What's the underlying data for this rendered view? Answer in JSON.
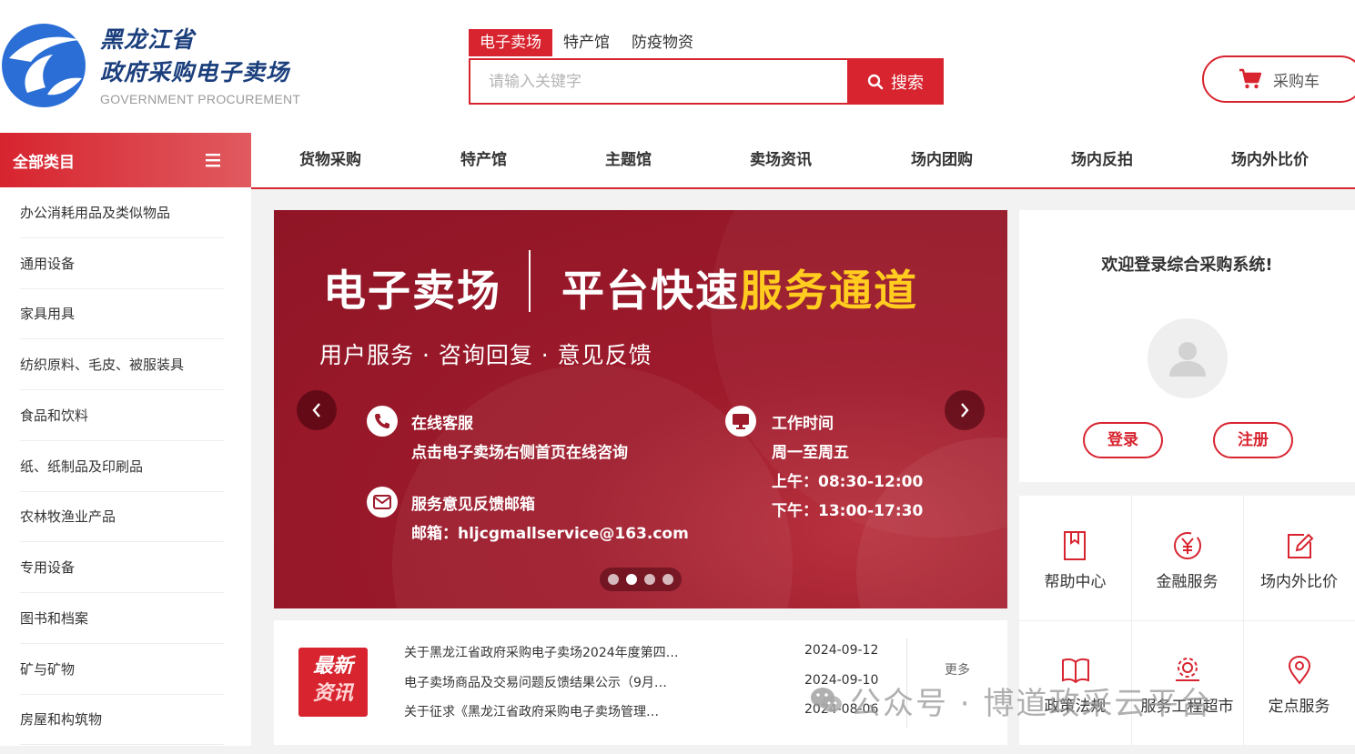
{
  "logo": {
    "title_line1": "黑龙江省",
    "title_line2": "政府采购电子卖场",
    "subtitle_en": "GOVERNMENT PROCUREMENT"
  },
  "search": {
    "tabs": [
      "电子卖场",
      "特产馆",
      "防疫物资"
    ],
    "active_tab": "电子卖场",
    "placeholder": "请输入关键字",
    "button_label": "搜索"
  },
  "cart": {
    "label": "采购车"
  },
  "categories": {
    "header": "全部类目",
    "items": [
      "办公消耗用品及类似物品",
      "通用设备",
      "家具用具",
      "纺织原料、毛皮、被服装具",
      "食品和饮料",
      "纸、纸制品及印刷品",
      "农林牧渔业产品",
      "专用设备",
      "图书和档案",
      "矿与矿物",
      "房屋和构筑物"
    ]
  },
  "nav": {
    "items": [
      "货物采购",
      "特产馆",
      "主题馆",
      "卖场资讯",
      "场内团购",
      "场内反拍",
      "场内外比价"
    ]
  },
  "banner": {
    "title_left": "电子卖场",
    "title_right_plain": "平台快速",
    "title_right_highlight": "服务通道",
    "subtitle": "用户服务 · 咨询回复 · 意见反馈",
    "online_service_title": "在线客服",
    "online_service_desc": "点击电子卖场右侧首页在线咨询",
    "feedback_title": "服务意见反馈邮箱",
    "feedback_email": "邮箱：hljcgmallservice@163.com",
    "hours_title": "工作时间",
    "hours_days": "周一至周五",
    "hours_am": "上午：08:30-12:00",
    "hours_pm": "下午：13:00-17:30",
    "slide_count": 4,
    "active_slide": 2
  },
  "login": {
    "welcome": "欢迎登录综合采购系统!",
    "login_label": "登录",
    "register_label": "注册"
  },
  "services": [
    {
      "label": "帮助中心",
      "icon": "bookmark-icon"
    },
    {
      "label": "金融服务",
      "icon": "yuan-coin-icon"
    },
    {
      "label": "场内外比价",
      "icon": "edit-icon"
    },
    {
      "label": "政策法规",
      "icon": "book-icon"
    },
    {
      "label": "服务工程超市",
      "icon": "gear-icon"
    },
    {
      "label": "定点服务",
      "icon": "location-pin-icon"
    }
  ],
  "news": {
    "badge_line1": "最新",
    "badge_line2": "资讯",
    "more_label": "更多",
    "items": [
      {
        "title": "关于黑龙江省政府采购电子卖场2024年度第四批…",
        "date": "2024-09-12"
      },
      {
        "title": "电子卖场商品及交易问题反馈结果公示（9月…",
        "date": "2024-09-10"
      },
      {
        "title": "关于征求《黑龙江省政府采购电子卖场管理…",
        "date": "2024-08-06"
      }
    ]
  },
  "watermark": {
    "text": "公众号 · 博道政采云平台"
  },
  "colors": {
    "brand_red": "#d7242f",
    "highlight_yellow": "#ffcc1f",
    "logo_blue": "#1b3f7d"
  }
}
